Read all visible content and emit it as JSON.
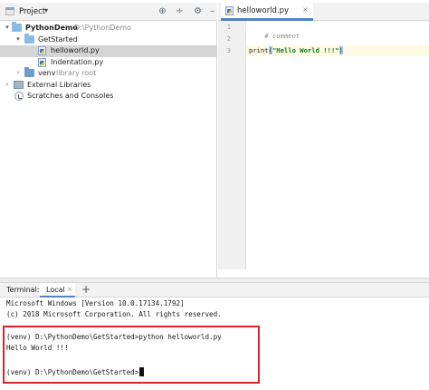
{
  "project_panel": {
    "title": "Project",
    "caret": "▾",
    "tools": {
      "locate_icon": "target-icon",
      "split_icon": "collapse-icon",
      "settings_icon": "gear-icon",
      "minimize_icon": "minimize-icon"
    },
    "tree": [
      {
        "name": "PythonDemo",
        "hint": "D:\\PythonDemo",
        "type": "folder",
        "expanded": true
      },
      {
        "name": "GetStarted",
        "type": "folder",
        "expanded": true
      },
      {
        "name": "helloworld.py",
        "type": "python-file",
        "selected": true
      },
      {
        "name": "Indentation.py",
        "type": "python-file"
      },
      {
        "name": "venv",
        "hint": "library root",
        "type": "folder",
        "expanded": false
      },
      {
        "name": "External Libraries",
        "type": "libraries",
        "expanded": false
      },
      {
        "name": "Scratches and Consoles",
        "type": "scratches"
      }
    ]
  },
  "editor": {
    "tab": {
      "label": "helloworld.py",
      "close": "×"
    },
    "line_numbers": [
      "1",
      "2",
      "3"
    ],
    "lines": {
      "comment": "# comment",
      "print_fn": "print",
      "open_paren": "(",
      "string": "\"Hello World !!!\"",
      "close_paren": ")"
    }
  },
  "terminal": {
    "label": "Terminal:",
    "tab": {
      "label": "Local",
      "close": "×"
    },
    "add": "+",
    "lines": [
      "Microsoft Windows [Version 10.0.17134.1792]",
      "(c) 2018 Microsoft Corporation. All rights reserved.",
      "",
      "(venv) D:\\PythonDemo\\GetStarted>python helloworld.py",
      "Hello World !!!",
      "",
      "(venv) D:\\PythonDemo\\GetStarted>"
    ],
    "highlight_color": "#d9262e"
  }
}
